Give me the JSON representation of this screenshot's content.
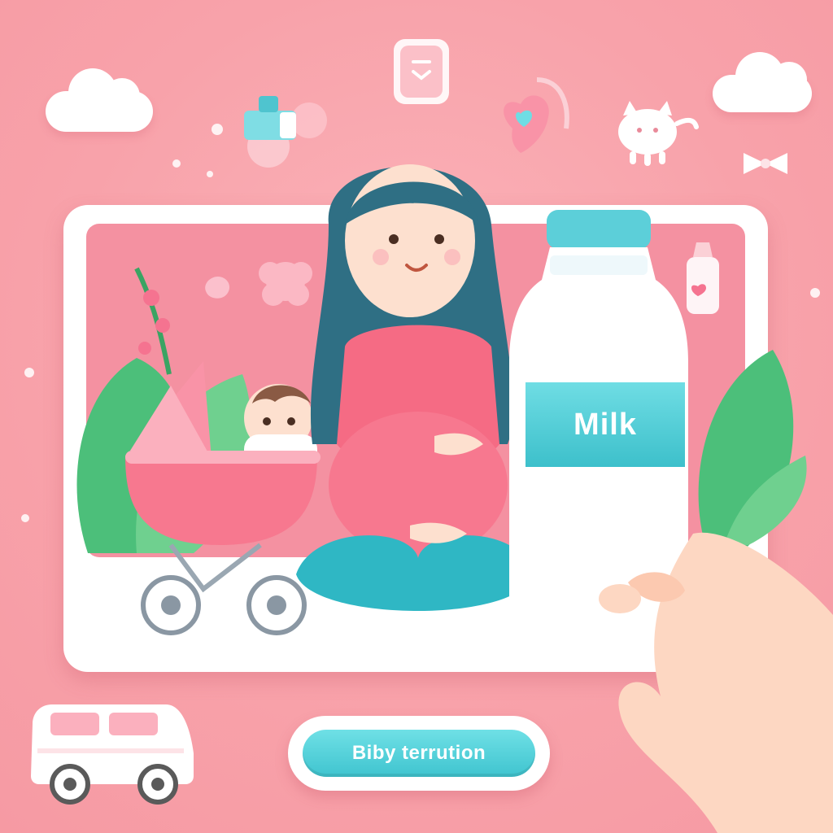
{
  "milk_label": "Milk",
  "cta_label": "Biby terrution",
  "colors": {
    "background": "#f8a2aa",
    "accent": "#3fc4cf",
    "pink": "#f7788f",
    "green": "#4cbf7a",
    "white": "#ffffff"
  },
  "icons": [
    "cloud-icon",
    "bottle-icon",
    "device-icon",
    "heart-pacifier-icon",
    "cat-toy-icon",
    "bow-icon",
    "baby-bottle-icon",
    "flower-icon",
    "van-icon",
    "hand-icon"
  ]
}
